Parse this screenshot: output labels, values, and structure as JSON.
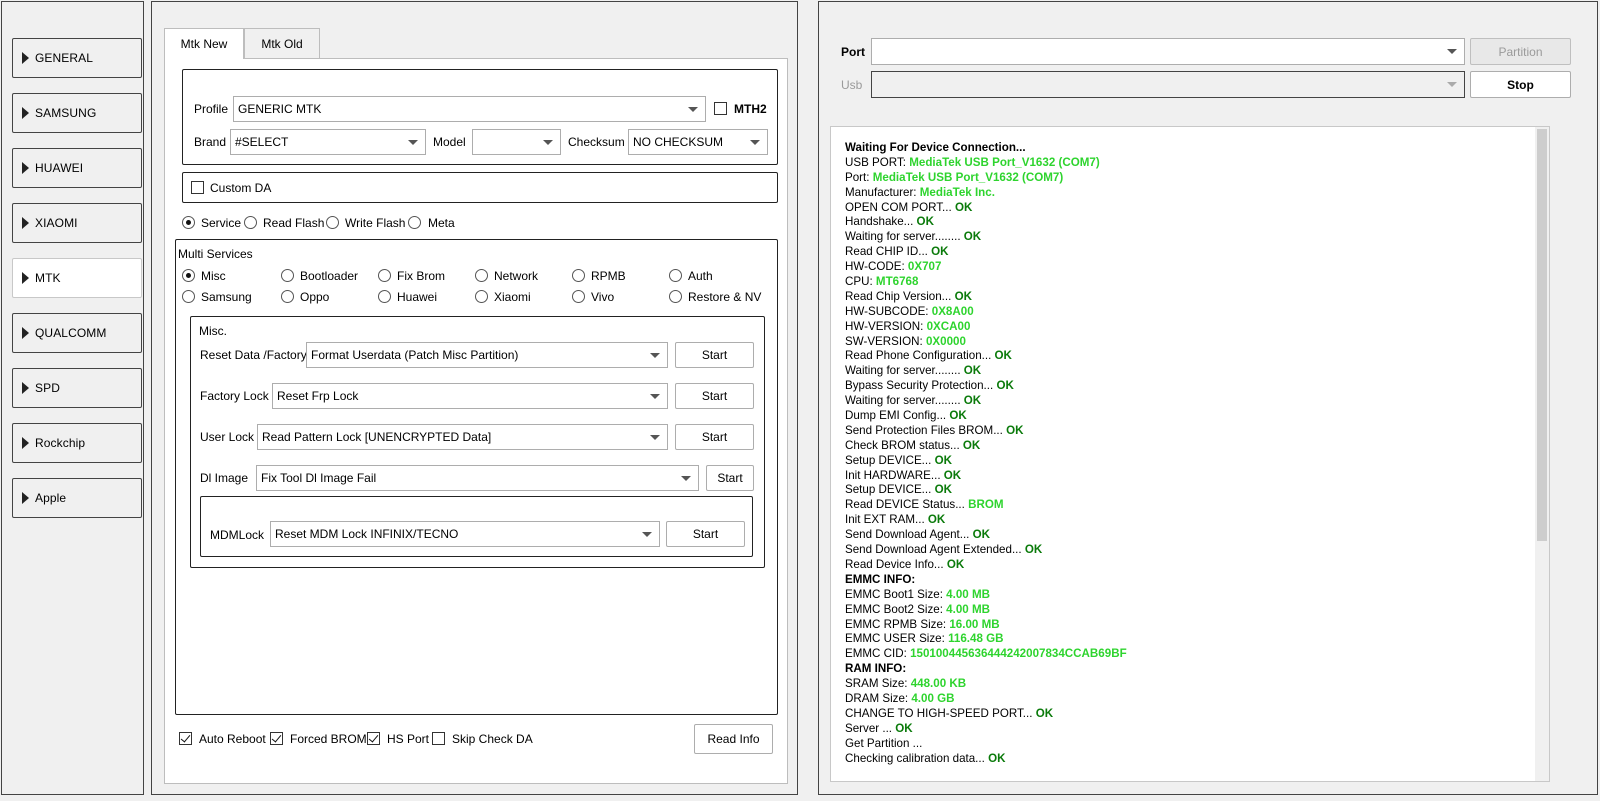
{
  "sidebar": {
    "items": [
      {
        "label": "GENERAL",
        "active": false
      },
      {
        "label": "SAMSUNG",
        "active": false
      },
      {
        "label": "HUAWEI",
        "active": false
      },
      {
        "label": "XIAOMI",
        "active": false
      },
      {
        "label": "MTK",
        "active": true
      },
      {
        "label": "QUALCOMM",
        "active": false
      },
      {
        "label": "SPD",
        "active": false
      },
      {
        "label": "Rockchip",
        "active": false
      },
      {
        "label": "Apple",
        "active": false
      }
    ]
  },
  "tabs": [
    {
      "label": "Mtk New",
      "active": true
    },
    {
      "label": "Mtk Old",
      "active": false
    }
  ],
  "device": {
    "profile_label": "Profile",
    "profile_value": "GENERIC MTK",
    "mth2_label": "MTH2",
    "mth2_checked": false,
    "brand_label": "Brand",
    "brand_value": "#SELECT",
    "model_label": "Model",
    "model_value": "",
    "checksum_label": "Checksum",
    "checksum_value": "NO CHECKSUM"
  },
  "custom_da": {
    "label": "Custom DA",
    "checked": false
  },
  "modes": {
    "selected": "Service",
    "options": [
      "Service",
      "Read Flash",
      "Write Flash",
      "Meta"
    ]
  },
  "multi_services": {
    "title": "Multi Services",
    "selected": "Misc",
    "row1": [
      "Misc",
      "Bootloader",
      "Fix Brom",
      "Network",
      "RPMB",
      "Auth"
    ],
    "row2": [
      "Samsung",
      "Oppo",
      "Huawei",
      "Xiaomi",
      "Vivo",
      "Restore & NV"
    ]
  },
  "misc": {
    "title": "Misc.",
    "rows": [
      {
        "label": "Reset Data /Factory",
        "value": "Format Userdata (Patch Misc Partition)",
        "button": "Start"
      },
      {
        "label": "Factory Lock",
        "value": "Reset Frp Lock",
        "button": "Start"
      },
      {
        "label": "User Lock",
        "value": "Read Pattern Lock [UNENCRYPTED Data]",
        "button": "Start"
      },
      {
        "label": "Dl Image",
        "value": "Fix Tool Dl Image Fail",
        "button": "Start"
      }
    ],
    "mdm": {
      "label": "MDMLock",
      "value": "Reset MDM Lock INFINIX/TECNO",
      "button": "Start"
    }
  },
  "footer": {
    "options": [
      {
        "label": "Auto Reboot",
        "checked": true
      },
      {
        "label": "Forced BROM",
        "checked": true
      },
      {
        "label": "HS Port",
        "checked": true
      },
      {
        "label": "Skip Check DA",
        "checked": false
      }
    ],
    "read_info": "Read Info"
  },
  "connection": {
    "port_label": "Port",
    "port_value": "",
    "usb_label": "Usb",
    "usb_value": "",
    "partition_button": "Partition",
    "stop_button": "Stop"
  },
  "log": [
    {
      "text": "Waiting For Device Connection...",
      "bold": true
    },
    {
      "text": "USB PORT: ",
      "value": "MediaTek USB Port_V1632 (COM7)",
      "style": "hi"
    },
    {
      "text": "Port: ",
      "value": "MediaTek USB Port_V1632 (COM7)",
      "style": "hi"
    },
    {
      "text": "Manufacturer: ",
      "value": "MediaTek Inc.",
      "style": "hi"
    },
    {
      "text": "OPEN COM PORT... ",
      "value": "OK",
      "style": "ok"
    },
    {
      "text": "Handshake... ",
      "value": "OK",
      "style": "ok"
    },
    {
      "text": "Waiting for server........ ",
      "value": "OK",
      "style": "ok"
    },
    {
      "text": "Read CHIP ID... ",
      "value": "OK",
      "style": "ok"
    },
    {
      "text": "HW-CODE: ",
      "value": "0X707",
      "style": "hi"
    },
    {
      "text": "CPU: ",
      "value": "MT6768",
      "style": "hi"
    },
    {
      "text": "Read Chip Version... ",
      "value": "OK",
      "style": "ok"
    },
    {
      "text": "HW-SUBCODE: ",
      "value": "0X8A00",
      "style": "hi"
    },
    {
      "text": "HW-VERSION: ",
      "value": "0XCA00",
      "style": "hi"
    },
    {
      "text": "SW-VERSION: ",
      "value": "0X0000",
      "style": "hi"
    },
    {
      "text": "Read Phone Configuration... ",
      "value": "OK",
      "style": "ok"
    },
    {
      "text": "Waiting for server........ ",
      "value": "OK",
      "style": "ok"
    },
    {
      "text": "Bypass Security Protection... ",
      "value": "OK",
      "style": "ok"
    },
    {
      "text": "Waiting for server........ ",
      "value": "OK",
      "style": "ok"
    },
    {
      "text": "Dump EMI Config... ",
      "value": "OK",
      "style": "ok"
    },
    {
      "text": "Send Protection Files BROM... ",
      "value": "OK",
      "style": "ok"
    },
    {
      "text": "Check BROM status... ",
      "value": "OK",
      "style": "ok"
    },
    {
      "text": "Setup DEVICE... ",
      "value": "OK",
      "style": "ok"
    },
    {
      "text": "Init HARDWARE... ",
      "value": "OK",
      "style": "ok"
    },
    {
      "text": "Setup DEVICE... ",
      "value": "OK",
      "style": "ok"
    },
    {
      "text": "Read DEVICE Status... ",
      "value": "BROM",
      "style": "hi"
    },
    {
      "text": "Init EXT RAM... ",
      "value": "OK",
      "style": "ok"
    },
    {
      "text": "Send Download Agent... ",
      "value": "OK",
      "style": "ok"
    },
    {
      "text": "Send Download Agent Extended... ",
      "value": "OK",
      "style": "ok"
    },
    {
      "text": "Read Device Info... ",
      "value": "OK",
      "style": "ok"
    },
    {
      "text": "EMMC INFO:",
      "bold": true
    },
    {
      "text": "EMMC Boot1 Size: ",
      "value": "4.00 MB",
      "style": "hi"
    },
    {
      "text": "EMMC Boot2 Size: ",
      "value": "4.00 MB",
      "style": "hi"
    },
    {
      "text": "EMMC RPMB Size: ",
      "value": "16.00 MB",
      "style": "hi"
    },
    {
      "text": "EMMC USER Size: ",
      "value": "116.48 GB",
      "style": "hi"
    },
    {
      "text": "EMMC CID: ",
      "value": "150100445636444242007834CCAB69BF",
      "style": "hi"
    },
    {
      "text": "RAM INFO:",
      "bold": true
    },
    {
      "text": "SRAM Size: ",
      "value": "448.00 KB",
      "style": "hi"
    },
    {
      "text": "DRAM Size: ",
      "value": "4.00 GB",
      "style": "hi"
    },
    {
      "text": "CHANGE TO HIGH-SPEED PORT... ",
      "value": "OK",
      "style": "ok"
    },
    {
      "text": "Server ... ",
      "value": "OK",
      "style": "ok"
    },
    {
      "text": "Get Partition ..."
    },
    {
      "text": "Checking calibration data... ",
      "value": "OK",
      "style": "ok"
    }
  ]
}
